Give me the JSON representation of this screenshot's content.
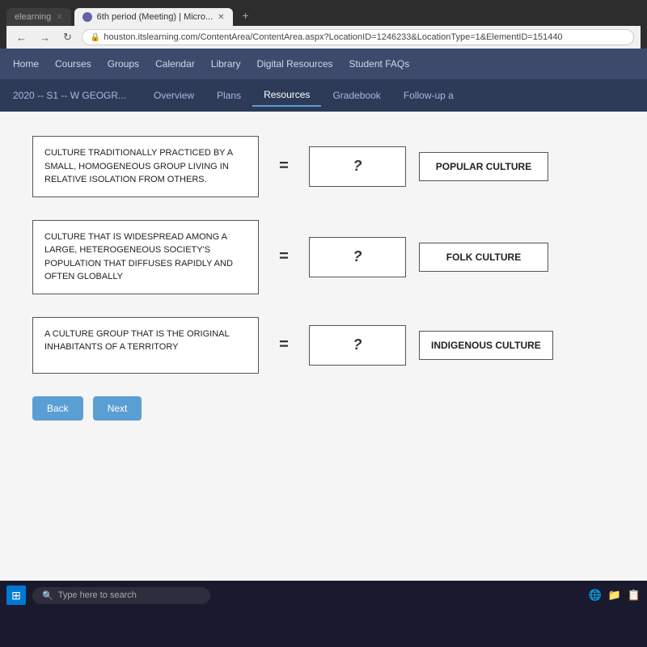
{
  "browser": {
    "tabs": [
      {
        "label": "elearning",
        "active": false
      },
      {
        "label": "6th period (Meeting) | Micro...",
        "active": true,
        "icon": true
      }
    ],
    "url": "houston.itslearning.com/ContentArea/ContentArea.aspx?LocationID=1246233&LocationType=1&ElementID=151440",
    "new_tab_label": "+"
  },
  "app_nav": {
    "items": [
      "Home",
      "Courses",
      "Groups",
      "Calendar",
      "Library",
      "Digital Resources",
      "Student FAQs"
    ]
  },
  "sub_nav": {
    "course_title": "2020 -- S1 -- W GEOGR...",
    "tabs": [
      {
        "label": "Overview",
        "active": false
      },
      {
        "label": "Plans",
        "active": false
      },
      {
        "label": "Resources",
        "active": true
      },
      {
        "label": "Gradebook",
        "active": false
      },
      {
        "label": "Follow-up a",
        "active": false
      }
    ]
  },
  "matching": {
    "rows": [
      {
        "definition": "CULTURE TRADITIONALLY PRACTICED BY A SMALL, HOMOGENEOUS GROUP LIVING IN RELATIVE ISOLATION FROM OTHERS.",
        "answer": "?",
        "label": "POPULAR CULTURE"
      },
      {
        "definition": "CULTURE THAT IS WIDESPREAD AMONG A LARGE, HETEROGENEOUS SOCIETY'S POPULATION THAT DIFFUSES RAPIDLY AND OFTEN GLOBALLY",
        "answer": "?",
        "label": "FOLK CULTURE"
      },
      {
        "definition": "A CULTURE GROUP THAT IS THE ORIGINAL INHABITANTS OF A TERRITORY",
        "answer": "?",
        "label": "INDIGENOUS CULTURE"
      }
    ],
    "equals_sign": "="
  },
  "buttons": {
    "back_label": "Back",
    "next_label": "Next"
  },
  "taskbar": {
    "search_placeholder": "Type here to search"
  }
}
